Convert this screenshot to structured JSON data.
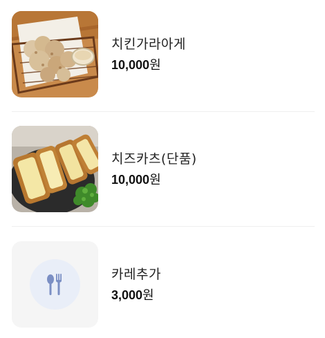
{
  "menu": {
    "items": [
      {
        "name": "치킨가라아게",
        "price": "10,000",
        "currency": "원",
        "image": "fried-chicken-karaage-photo"
      },
      {
        "name": "치즈카츠(단품)",
        "price": "10,000",
        "currency": "원",
        "image": "cheese-katsu-photo"
      },
      {
        "name": "카레추가",
        "price": "3,000",
        "currency": "원",
        "image": "fork-spoon-icon"
      }
    ]
  },
  "colors": {
    "placeholder_bg": "#f5f5f5",
    "placeholder_circle": "#e9eef8",
    "placeholder_icon": "#7b8fc4",
    "divider": "#eeeeee"
  }
}
